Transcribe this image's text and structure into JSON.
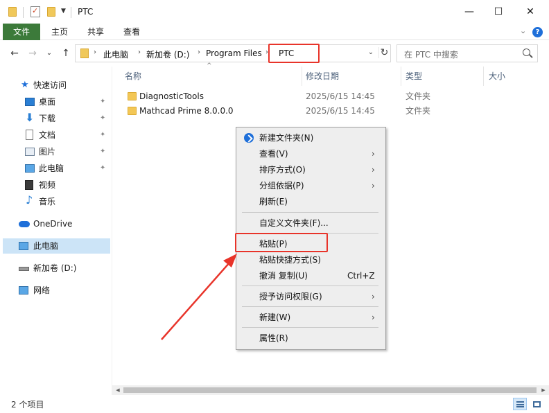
{
  "window": {
    "title": "PTC",
    "minimize_glyph": "—",
    "maximize_glyph": "☐",
    "close_glyph": "✕"
  },
  "ribbon": {
    "tabs": [
      {
        "label": "文件",
        "active": true
      },
      {
        "label": "主页"
      },
      {
        "label": "共享"
      },
      {
        "label": "查看"
      }
    ],
    "expand_glyph": "⌄",
    "help_glyph": "?"
  },
  "nav": {
    "back": "←",
    "forward": "→",
    "recent": "⌄",
    "up": "↑"
  },
  "address": {
    "crumbs": [
      "此电脑",
      "新加卷 (D:)",
      "Program Files",
      "PTC"
    ],
    "separator": "›",
    "dropdown": "⌄",
    "refresh": "↻"
  },
  "search": {
    "placeholder": "在 PTC 中搜索"
  },
  "sidebar": {
    "items": [
      {
        "label": "快速访问",
        "icon": "star-icon"
      },
      {
        "label": "桌面",
        "icon": "desktop-icon",
        "pinned": true
      },
      {
        "label": "下载",
        "icon": "download-icon",
        "pinned": true
      },
      {
        "label": "文档",
        "icon": "document-icon",
        "pinned": true
      },
      {
        "label": "图片",
        "icon": "picture-icon",
        "pinned": true
      },
      {
        "label": "此电脑",
        "icon": "computer-icon",
        "pinned": true
      },
      {
        "label": "视频",
        "icon": "video-icon"
      },
      {
        "label": "音乐",
        "icon": "music-icon"
      },
      {
        "label": "OneDrive",
        "icon": "cloud-icon"
      },
      {
        "label": "此电脑",
        "icon": "computer-icon",
        "selected": true
      },
      {
        "label": "新加卷 (D:)",
        "icon": "drive-icon"
      },
      {
        "label": "网络",
        "icon": "network-icon"
      }
    ],
    "pin_glyph": "📌"
  },
  "columns": {
    "name": "名称",
    "modified": "修改日期",
    "type": "类型",
    "size": "大小",
    "sort_glyph": "^"
  },
  "files": [
    {
      "name": "DiagnosticTools",
      "modified": "2025/6/15 14:45",
      "type": "文件夹"
    },
    {
      "name": "Mathcad Prime 8.0.0.0",
      "modified": "2025/6/15 14:45",
      "type": "文件夹"
    }
  ],
  "context_menu": {
    "items": [
      {
        "label": "新建文件夹(N)",
        "icon": "new-folder-icon"
      },
      {
        "label": "查看(V)",
        "submenu": true
      },
      {
        "label": "排序方式(O)",
        "submenu": true
      },
      {
        "label": "分组依据(P)",
        "submenu": true
      },
      {
        "label": "刷新(E)"
      },
      {
        "label": "自定义文件夹(F)..."
      },
      {
        "label": "粘贴(P)",
        "highlighted": true
      },
      {
        "label": "粘贴快捷方式(S)"
      },
      {
        "label": "撤消 复制(U)",
        "shortcut": "Ctrl+Z"
      },
      {
        "label": "授予访问权限(G)",
        "submenu": true
      },
      {
        "label": "新建(W)",
        "submenu": true
      },
      {
        "label": "属性(R)"
      }
    ],
    "submenu_glyph": "›"
  },
  "status": {
    "item_count": "2 个项目"
  },
  "colors": {
    "file_tab": "#3c7a3a",
    "highlight": "#e8342a",
    "selected": "#cce4f7"
  }
}
